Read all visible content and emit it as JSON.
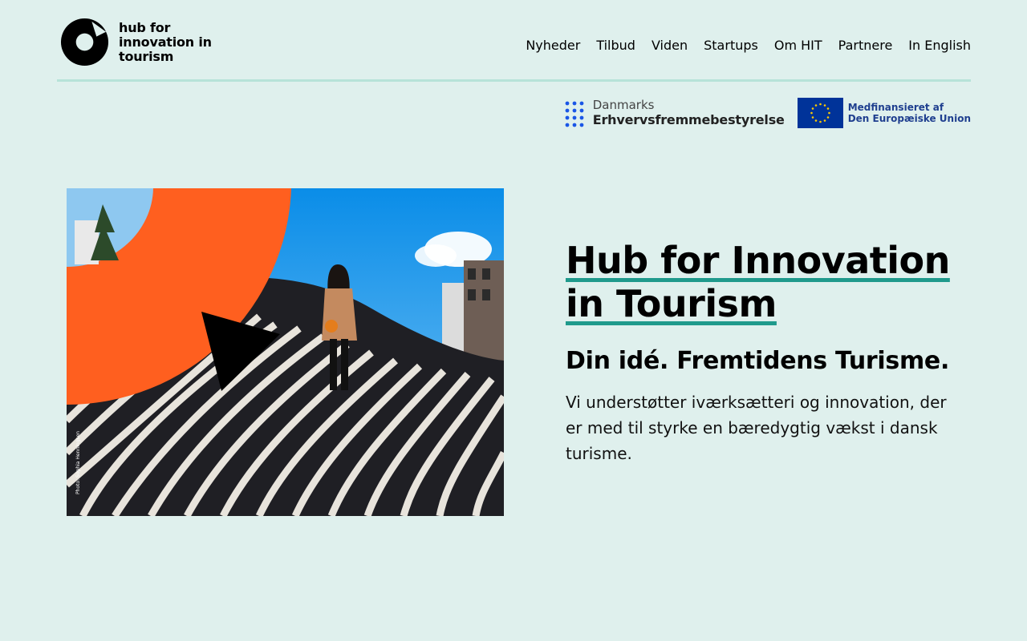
{
  "logo": {
    "text": "hub for innovation in tourism"
  },
  "nav": {
    "items": [
      {
        "label": "Nyheder"
      },
      {
        "label": "Tilbud"
      },
      {
        "label": "Viden"
      },
      {
        "label": "Startups"
      },
      {
        "label": "Om HIT"
      },
      {
        "label": "Partnere"
      },
      {
        "label": "In English"
      }
    ]
  },
  "sponsors": {
    "dk_line1": "Danmarks",
    "dk_line2": "Erhvervsfremmebestyrelse",
    "eu_line1": "Medfinansieret af",
    "eu_line2": "Den Europæiske Union"
  },
  "hero": {
    "image_credit": "Photo: Sophia Henningsen",
    "title_line1": "Hub for Innovation",
    "title_line2": "in Tourism",
    "subtitle": "Din idé. Fremtidens Turisme.",
    "body": "Vi understøtter iværksætteri og innovation, der er med til styrke en bæredygtig vækst i dansk turisme."
  },
  "colors": {
    "background": "#dff0ed",
    "accent_teal": "#1f9a8c",
    "header_rule": "#b7e3d9",
    "orange": "#ff5f1f",
    "eu_blue": "#003399"
  },
  "icons": {
    "logo": "hit-logo-icon",
    "dk": "danmarks-dots-icon",
    "eu": "eu-flag-icon"
  }
}
